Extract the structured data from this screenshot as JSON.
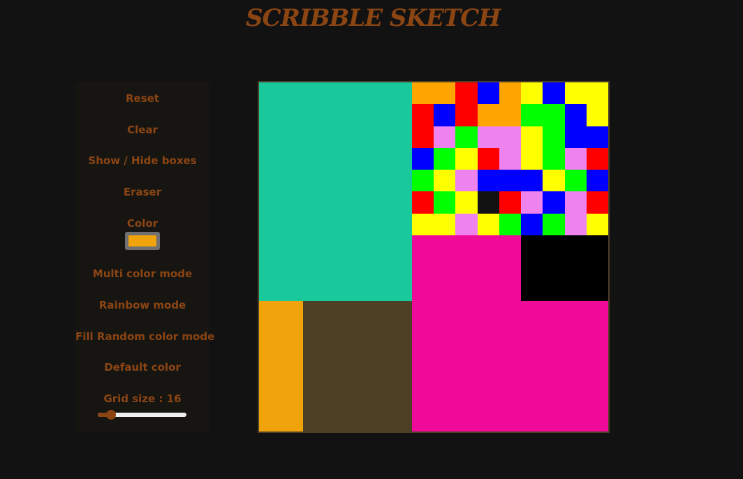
{
  "app": {
    "title": "SCRIBBLE SKETCH"
  },
  "controls": {
    "reset_label": "Reset",
    "clear_label": "Clear",
    "toggle_boxes_label": "Show / Hide boxes",
    "eraser_label": "Eraser",
    "color_label": "Color",
    "current_color": "#f0a30a",
    "multi_color_label": "Multi color mode",
    "rainbow_label": "Rainbow mode",
    "fill_random_label": "Fill Random color mode",
    "default_color_label": "Default color",
    "grid_size_label": "Grid size : 16",
    "grid_size": 16,
    "grid_size_min": 1,
    "grid_size_max": 100
  },
  "colors": {
    "accent": "#8b4513",
    "background": "#121212",
    "panel": "#171512"
  },
  "grid": {
    "size": 16,
    "palette": {
      "T": "#19c99c",
      "O": "#ffa500",
      "R": "#ff0000",
      "B": "#0000ff",
      "Y": "#ffff00",
      "G": "#00ff00",
      "V": "#ee82ee",
      "K": "#121212",
      "M": "#f00a9a",
      "X": "#000000",
      "A": "#f0a30a",
      "W": "#4d4025"
    },
    "rows": [
      "TTTTTTTOORBOYBYY",
      "TTTTTTTRBROOGGBY",
      "TTTTTTTRVGVVYGBB",
      "TTTTTTTBGYRVYGVR",
      "TTTTTTTGYVBBBYGB",
      "TTTTTTTRGYKRVBVR",
      "TTTTTTTYYVYGBGVY",
      "TTTTTTTMMMMMXXXX",
      "TTTTTTTMMMMMXXXX",
      "TTTTTTTMMMMMXXXX",
      "AAWWWWWMMMMMMMMM",
      "AAWWWWWMMMMMMMMM",
      "AAWWWWWMMMMMMMMM",
      "AAWWWWWMMMMMMMMM",
      "AAWWWWWMMMMMMMMM",
      "AAWWWWWMMMMMMMMM"
    ]
  }
}
